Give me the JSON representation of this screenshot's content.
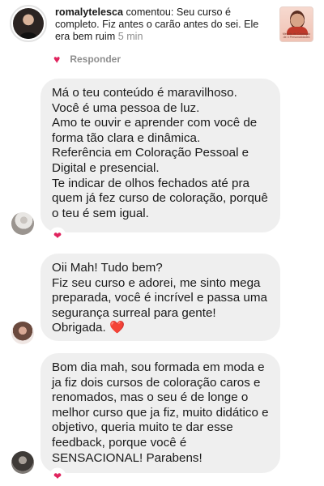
{
  "notification": {
    "username": "romalytelesca",
    "text": " comentou: Seu curso é completo.  Fiz antes o carão antes do sei. Ele era bem ruim ",
    "time": "5 min",
    "thumb_caption": "Método de Coloração de 3 Personalidades",
    "like_icon": "heart-icon",
    "reply_label": "Responder"
  },
  "messages": [
    {
      "lines": [
        "Má o teu conteúdo é maravilhoso.",
        "Você é uma pessoa de luz.",
        "Amo te ouvir e aprender com você de forma tão clara e dinâmica.",
        "Referência em Coloração Pessoal e Digital e presencial.",
        "Te indicar de olhos fechados até pra quem já fez curso de coloração, porquê o teu é sem igual."
      ],
      "reaction": "❤"
    },
    {
      "lines": [
        "Oii Mah! Tudo bem?",
        "Fiz seu curso e adorei, me sinto mega preparada, você é incrível e passa uma segurança surreal para gente!",
        "Obrigada."
      ],
      "trailing_emoji": "❤️"
    },
    {
      "lines": [
        "Bom dia mah, sou formada em moda e ja fiz dois cursos de coloração caros e renomados, mas o seu é de longe o melhor curso que ja fiz, muito didático e objetivo, queria muito te dar esse feedback, porque você é SENSACIONAL! Parabens!"
      ],
      "reaction": "❤"
    }
  ],
  "colors": {
    "bubble": "#efefef",
    "heart": "#e0245e",
    "muted": "#8e8e8e"
  }
}
